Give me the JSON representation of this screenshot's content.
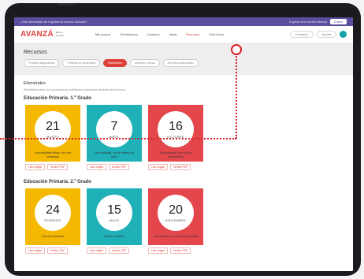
{
  "promo": {
    "text": "¿Has terminado de registrar tu acceso avanzá?",
    "right_text": "Ingresa a tu sesión Alianza",
    "button": "Entrar"
  },
  "header": {
    "logo": "AVANZÁ",
    "logo_sub": "Banco Leones",
    "nav": [
      "Mis grupos",
      "Mi biblioteca",
      "Usuarios",
      "Ideas",
      "Recursos",
      "Club lector"
    ],
    "active_nav_index": 4,
    "buttons": [
      "Contacto",
      "Ayuda"
    ]
  },
  "page": {
    "title": "Recursos",
    "tabs": [
      "Pruebas diagnósticas",
      "Pruebas de contenidos",
      "Efemérides",
      "Apuntes y fichas",
      "Recursos adicionales"
    ],
    "active_tab_index": 2
  },
  "section": {
    "title": "Efemérides",
    "description": "Efemérides ideas con un puñado de actividades preparadas alrededor de la lectura."
  },
  "groups": [
    {
      "title": "Educación Primaria. 1.º Grado",
      "cards": [
        {
          "day": "21",
          "month": "MARZO",
          "note": "Una actividad lúdica, con una estrategia",
          "color": "#f5b800",
          "actions": [
            "Libro digital",
            "Versión PDF"
          ]
        },
        {
          "day": "7",
          "month": "ABRIL",
          "note": "Una actividad, con la materia de salud",
          "color": "#1fb0b8",
          "actions": [
            "Libro digital",
            "Versión PDF"
          ]
        },
        {
          "day": "16",
          "month": "OCTUBRE",
          "note": "Una actividad, con la de la alimentación",
          "color": "#e3474b",
          "actions": [
            "Libro digital",
            "Versión PDF"
          ]
        }
      ]
    },
    {
      "title": "Educación Primaria. 2.º Grado",
      "cards": [
        {
          "day": "24",
          "month": "FEBRERO",
          "note": "Día de la bandera",
          "color": "#f5b800",
          "actions": [
            "Libro digital",
            "Versión PDF"
          ]
        },
        {
          "day": "15",
          "month": "MAYO",
          "note": "Día de la familia",
          "color": "#1fb0b8",
          "actions": [
            "Libro digital",
            "Versión PDF"
          ]
        },
        {
          "day": "20",
          "month": "NOVIEMBRE",
          "note": "Una actividad, con la de la soberanía",
          "color": "#e3474b",
          "actions": [
            "Libro digital",
            "Versión PDF"
          ]
        }
      ]
    }
  ],
  "annotation": {
    "color": "#d8202a"
  }
}
